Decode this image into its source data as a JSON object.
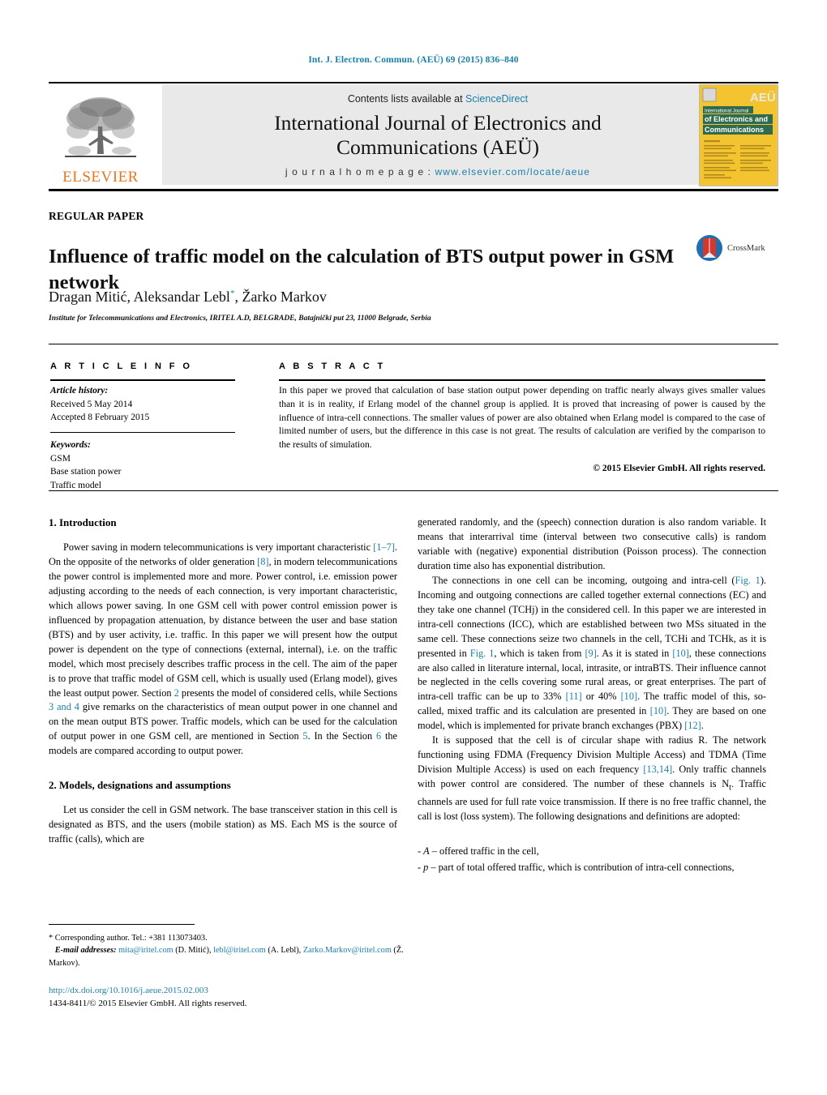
{
  "running_head": "Int. J. Electron. Commun. (AEÜ) 69 (2015) 836–840",
  "masthead": {
    "publisher": "ELSEVIER",
    "contents_prefix": "Contents lists available at ",
    "contents_link": "ScienceDirect",
    "journal_title_line1": "International Journal of Electronics and",
    "journal_title_line2": "Communications (AEÜ)",
    "homepage_prefix": "j o u r n a l   h o m e p a g e :  ",
    "homepage_url": "www.elsevier.com/locate/aeue",
    "cover_line1": "International Journal",
    "cover_line2": "of Electronics and",
    "cover_line3": "Communications",
    "cover_logo": "AEÜ"
  },
  "article": {
    "type_label": "REGULAR PAPER",
    "title": "Influence of traffic model on the calculation of BTS output power in GSM network",
    "authors": "Dragan Mitić, Aleksandar Lebl",
    "authors_tail": ", Žarko Markov",
    "author_marker": "*",
    "affiliation": "Institute for Telecommunications and Electronics, IRITEL A.D, BELGRADE, Batajnički put 23, 11000 Belgrade, Serbia",
    "crossmark_label": "CrossMark"
  },
  "info": {
    "heading": "A R T I C L E   I N F O",
    "history_label": "Article history:",
    "received": "Received 5 May 2014",
    "accepted": "Accepted 8 February 2015",
    "keywords_label": "Keywords:",
    "keywords": [
      "GSM",
      "Base station power",
      "Traffic model"
    ]
  },
  "abstract": {
    "heading": "A B S T R A C T",
    "text": "In this paper we proved that calculation of base station output power depending on traffic nearly always gives smaller values than it is in reality, if Erlang model of the channel group is applied. It is proved that increasing of power is caused by the influence of intra-cell connections. The smaller values of power are also obtained when Erlang model is compared to the case of limited number of users, but the difference in this case is not great. The results of calculation are verified by the comparison to the results of simulation.",
    "copyright": "© 2015 Elsevier GmbH. All rights reserved."
  },
  "sections": {
    "introduction_heading": "1.  Introduction",
    "models_heading": "2.  Models, designations and assumptions"
  },
  "body": {
    "intro_p1_a": "Power saving in modern telecommunications is very important characteristic ",
    "intro_ref_1_7": "[1–7]",
    "intro_p1_b": ". On the opposite of the networks of older generation ",
    "intro_ref_8": "[8]",
    "intro_p1_c": ", in modern telecommunications the power control is implemented more and more. Power control, i.e. emission power adjusting according to the needs of each connection, is very important characteristic, which allows power saving. In one GSM cell with power control emission power is influenced by propagation attenuation, by distance between the user and base station (BTS) and by user activity, i.e. traffic. In this paper we will present how the output power is dependent on the type of connections (external, internal), i.e. on the traffic model, which most precisely describes traffic process in the cell. The aim of the paper is to prove that traffic model of GSM cell, which is usually used (Erlang model), gives the least output power. Section ",
    "intro_ref_sec2": "2",
    "intro_p1_d": " presents the model of considered cells, while Sections ",
    "intro_ref_sec34": "3 and 4",
    "intro_p1_e": " give remarks on the characteristics of mean output power in one channel and on the mean output BTS power. Traffic models, which can be used for the calculation of output power in one GSM cell, are mentioned in Section ",
    "intro_ref_sec5": "5",
    "intro_p1_f": ". In the Section ",
    "intro_ref_sec6": "6",
    "intro_p1_g": " the models are compared according to output power.",
    "models_p1": "Let us consider the cell in GSM network. The base transceiver station in this cell is designated as BTS, and the users (mobile station) as MS. Each MS is the source of traffic (calls), which are",
    "right_p1": "generated randomly, and the (speech) connection duration is also random variable. It means that interarrival time (interval between two consecutive calls) is random variable with (negative) exponential distribution (Poisson process). The connection duration time also has exponential distribution.",
    "right_p2_a": "The connections in one cell can be incoming, outgoing and intra-cell (",
    "right_ref_fig1a": "Fig. 1",
    "right_p2_b": "). Incoming and outgoing connections are called together external connections (EC) and they take one channel (TCHj) in the considered cell. In this paper we are interested in intra-cell connections (ICC), which are established between two MSs situated in the same cell. These connections seize two channels in the cell, TCHi and TCHk, as it is presented in ",
    "right_ref_fig1b": "Fig. 1",
    "right_p2_c": ", which is taken from ",
    "right_ref_9": "[9]",
    "right_p2_d": ". As it is stated in ",
    "right_ref_10a": "[10]",
    "right_p2_e": ", these connections are also called in literature internal, local, intrasite, or intraBTS. Their influence cannot be neglected in the cells covering some rural areas, or great enterprises. The part of intra-cell traffic can be up to 33% ",
    "right_ref_11": "[11]",
    "right_p2_f": " or 40% ",
    "right_ref_10b": "[10]",
    "right_p2_g": ". The traffic model of this, so-called, mixed traffic and its calculation are presented in ",
    "right_ref_10c": "[10]",
    "right_p2_h": ". They are based on one model, which is implemented for private branch exchanges (PBX) ",
    "right_ref_12": "[12]",
    "right_p2_i": ".",
    "right_p3_a": "It is supposed that the cell is of circular shape with radius R. The network functioning using FDMA (Frequency Division Multiple Access) and TDMA (Time Division Multiple Access) is used on each frequency ",
    "right_ref_1314": "[13,14]",
    "right_p3_b": ". Only traffic channels with power control are considered. The number of these channels is N",
    "right_p3_sub": "t",
    "right_p3_c": ". Traffic channels are used for full rate voice transmission. If there is no free traffic channel, the call is lost (loss system). The following designations and definitions are adopted:",
    "def_1_sym": "A",
    "def_1_text": " – offered traffic in the cell,",
    "def_2_sym": "p",
    "def_2_text": " – part of total offered traffic, which is contribution of intra-cell connections,"
  },
  "footnote": {
    "corresponding": "* Corresponding author. Tel.: +381 113073403.",
    "email_label": "E-mail addresses:",
    "email1": "mita@iritel.com",
    "email1_owner": " (D. Mitić), ",
    "email2": "lebl@iritel.com",
    "email2_owner": " (A. Lebl), ",
    "email3": "Zarko.Markov@iritel.com",
    "email3_owner": " (Ž. Markov).",
    "doi": "http://dx.doi.org/10.1016/j.aeue.2015.02.003",
    "issn_line": "1434-8411/© 2015 Elsevier GmbH. All rights reserved."
  },
  "colors": {
    "link": "#1a7fa8",
    "elsevier_orange": "#e87722",
    "band_gray": "#e9e9e9"
  }
}
